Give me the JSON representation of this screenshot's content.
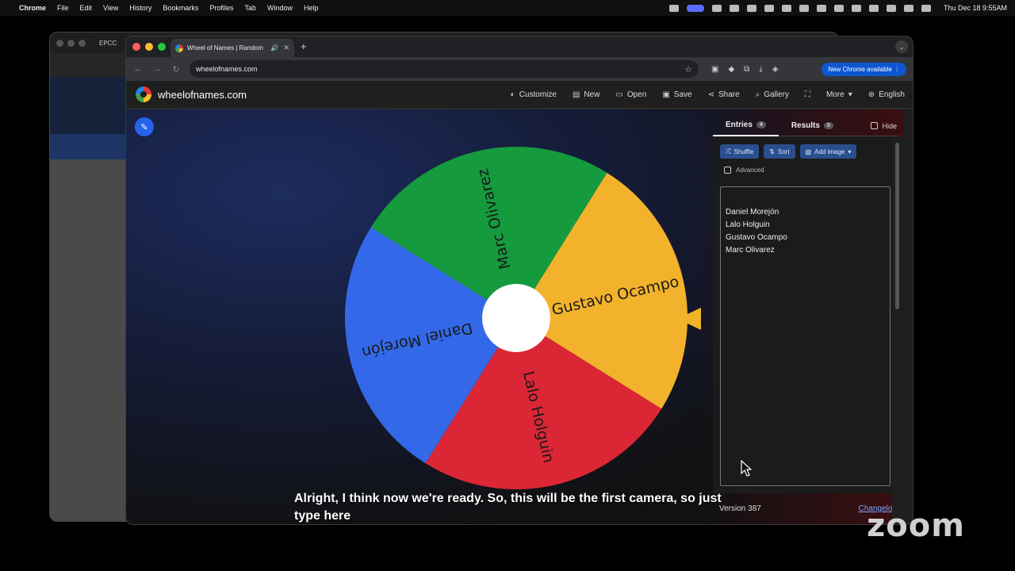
{
  "menubar": {
    "apple_icon": "apple-icon",
    "items": [
      "Chrome",
      "File",
      "Edit",
      "View",
      "History",
      "Bookmarks",
      "Profiles",
      "Tab",
      "Window",
      "Help"
    ],
    "clock": "Thu Dec 18  9:55AM"
  },
  "background_window": {
    "tab_title": "EPCC"
  },
  "browser": {
    "tab_title": "Wheel of Names | Random",
    "new_tab": "+",
    "url": "wheelofnames.com",
    "new_chrome": "New Chrome available"
  },
  "site": {
    "brand": "wheelofnames.com",
    "nav": [
      {
        "label": "Customize",
        "icon": "palette-icon"
      },
      {
        "label": "New",
        "icon": "file-icon"
      },
      {
        "label": "Open",
        "icon": "folder-icon"
      },
      {
        "label": "Save",
        "icon": "save-icon"
      },
      {
        "label": "Share",
        "icon": "share-icon"
      },
      {
        "label": "Gallery",
        "icon": "search-icon"
      },
      {
        "label": "",
        "icon": "fullscreen-icon"
      },
      {
        "label": "More",
        "icon": "chevron-down-icon"
      },
      {
        "label": "English",
        "icon": "globe-icon"
      }
    ]
  },
  "wheel": {
    "segments": [
      {
        "label": "Gustavo Ocampo",
        "color": "#F2B22C"
      },
      {
        "label": "Lalo Holguin",
        "color": "#DB2635"
      },
      {
        "label": "Daniel Morejón",
        "color": "#3369E8"
      },
      {
        "label": "Marc Olivarez",
        "color": "#159A3E"
      }
    ]
  },
  "panel": {
    "entries_tab": "Entries",
    "entries_count": "4",
    "results_tab": "Results",
    "results_count": "0",
    "hide_label": "Hide",
    "shuffle": "Shuffle",
    "sort": "Sort",
    "add_image": "Add image",
    "advanced": "Advanced",
    "entries": [
      "Daniel Morejón",
      "Lalo Holguin",
      "Gustavo Ocampo",
      "Marc Olivarez"
    ],
    "version": "Version 387",
    "changelog": "Changelog"
  },
  "caption": "Alright, I think now we're ready. So, this will be the first camera, so just type here",
  "zoom_watermark": "zoom"
}
